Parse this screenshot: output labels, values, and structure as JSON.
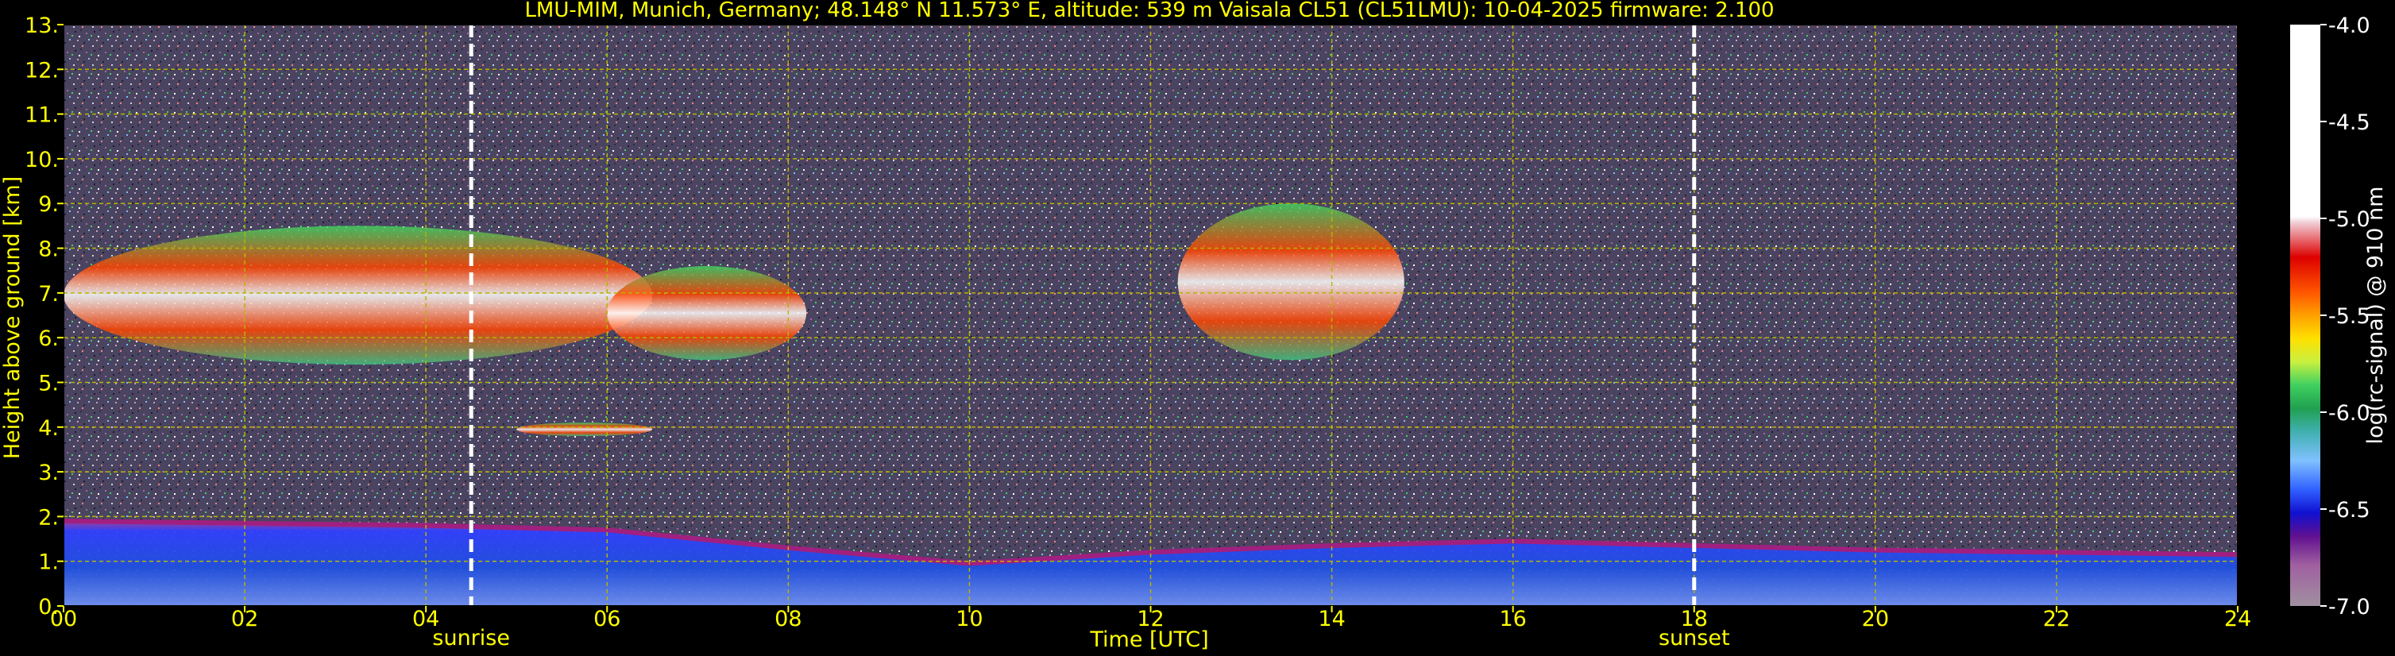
{
  "chart_data": {
    "type": "heatmap",
    "title": "LMU-MIM, Munich, Germany; 48.148° N 11.573° E, altitude: 539 m    Vaisala CL51 (CL51LMU): 10-04-2025    firmware: 2.100",
    "xlabel": "Time [UTC]",
    "ylabel": "Height above ground [km]",
    "colorbar_label": "log(rc-signal) @ 910 nm",
    "xlim": [
      0,
      24
    ],
    "ylim": [
      0,
      13
    ],
    "x_ticks": [
      "00",
      "02",
      "04",
      "06",
      "08",
      "10",
      "12",
      "14",
      "16",
      "18",
      "20",
      "22",
      "24"
    ],
    "y_ticks": [
      "0.",
      "1.",
      "2.",
      "3.",
      "4.",
      "5.",
      "6.",
      "7.",
      "8.",
      "9.",
      "10.",
      "11.",
      "12.",
      "13."
    ],
    "colorbar_range": [
      -7.0,
      -4.0
    ],
    "colorbar_ticks": [
      "-4.0",
      "-4.5",
      "-5.0",
      "-5.5",
      "-6.0",
      "-6.5",
      "-7.0"
    ],
    "grid": true,
    "annotations": [
      {
        "label": "sunrise",
        "time": 4.5
      },
      {
        "label": "sunset",
        "time": 18.0
      }
    ],
    "features": [
      {
        "kind": "cloud_layer",
        "time_start": 0.0,
        "time_end": 6.5,
        "height_low": 5.4,
        "height_high": 8.5
      },
      {
        "kind": "cloud_layer",
        "time_start": 6.0,
        "time_end": 8.2,
        "height_low": 5.5,
        "height_high": 7.6
      },
      {
        "kind": "cloud_layer",
        "time_start": 12.3,
        "time_end": 14.8,
        "height_low": 5.5,
        "height_high": 9.0
      },
      {
        "kind": "cloud_layer",
        "time_start": 5.0,
        "time_end": 6.5,
        "height_low": 3.8,
        "height_high": 4.1
      },
      {
        "kind": "boundary_layer_top",
        "time": [
          0,
          2,
          4,
          6,
          8,
          10,
          12,
          14,
          16,
          18,
          20,
          22,
          24
        ],
        "height": [
          1.9,
          1.85,
          1.8,
          1.7,
          1.3,
          0.95,
          1.2,
          1.35,
          1.45,
          1.35,
          1.25,
          1.2,
          1.15
        ]
      }
    ]
  },
  "colors": {
    "background": "#000000",
    "text": "#ffff00",
    "grid": "#b5b500",
    "marker_lines": "#ffffff",
    "colorbar_stops": [
      "#ffffff",
      "#f0d0d8",
      "#dd0000",
      "#ff4400",
      "#ffa000",
      "#ffe000",
      "#c8f040",
      "#40d060",
      "#30b878",
      "#40b0b0",
      "#80c0ff",
      "#3060ff",
      "#1010d0",
      "#601090",
      "#a060a0",
      "#c090c0",
      "#a090a0"
    ]
  }
}
